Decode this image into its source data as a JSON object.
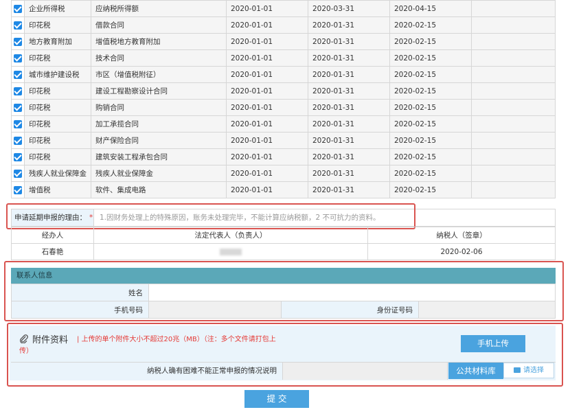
{
  "tax_rows": [
    {
      "type": "企业所得税",
      "item": "应纳税所得额",
      "start": "2020-01-01",
      "end": "2020-03-31",
      "due": "2020-04-15"
    },
    {
      "type": "印花税",
      "item": "借款合同",
      "start": "2020-01-01",
      "end": "2020-01-31",
      "due": "2020-02-15"
    },
    {
      "type": "地方教育附加",
      "item": "增值税地方教育附加",
      "start": "2020-01-01",
      "end": "2020-01-31",
      "due": "2020-02-15"
    },
    {
      "type": "印花税",
      "item": "技术合同",
      "start": "2020-01-01",
      "end": "2020-01-31",
      "due": "2020-02-15"
    },
    {
      "type": "城市维护建设税",
      "item": "市区（增值税附征）",
      "start": "2020-01-01",
      "end": "2020-01-31",
      "due": "2020-02-15"
    },
    {
      "type": "印花税",
      "item": "建设工程勘察设计合同",
      "start": "2020-01-01",
      "end": "2020-01-31",
      "due": "2020-02-15"
    },
    {
      "type": "印花税",
      "item": "购销合同",
      "start": "2020-01-01",
      "end": "2020-01-31",
      "due": "2020-02-15"
    },
    {
      "type": "印花税",
      "item": "加工承揽合同",
      "start": "2020-01-01",
      "end": "2020-01-31",
      "due": "2020-02-15"
    },
    {
      "type": "印花税",
      "item": "财产保险合同",
      "start": "2020-01-01",
      "end": "2020-01-31",
      "due": "2020-02-15"
    },
    {
      "type": "印花税",
      "item": "建筑安装工程承包合同",
      "start": "2020-01-01",
      "end": "2020-01-31",
      "due": "2020-02-15"
    },
    {
      "type": "残疾人就业保障金",
      "item": "残疾人就业保障金",
      "start": "2020-01-01",
      "end": "2020-01-31",
      "due": "2020-02-15"
    },
    {
      "type": "增值税",
      "item": "软件、集成电路",
      "start": "2020-01-01",
      "end": "2020-01-31",
      "due": "2020-02-15"
    }
  ],
  "reason": {
    "label": "申请延期申报的理由：",
    "required_mark": "*",
    "text": "1.因财务处理上的特殊原因，账务未处理完毕，不能计算应纳税额，2 不可抗力的资料。"
  },
  "signature": {
    "handler_label": "经办人",
    "legal_rep_label": "法定代表人（负责人）",
    "taxpayer_label": "纳税人（签章）",
    "handler_name": "石春艳",
    "date": "2020-02-06"
  },
  "contact": {
    "header": "联系人信息",
    "name_label": "姓名",
    "phone_label": "手机号码",
    "id_label": "身份证号码"
  },
  "attachments": {
    "title": "附件资料",
    "note": "| 上传的单个附件大小不超过20兆（MB）（注：多个文件请打包上传）",
    "mobile_upload": "手机上传",
    "explain_label": "纳税人确有困难不能正常申报的情况说明",
    "public_materials": "公共材料库",
    "choose": "请选择"
  },
  "submit_label": "提 交",
  "colors": {
    "accent": "#4aa3df",
    "highlight": "#d9534f",
    "header_teal": "#5ba8b8"
  }
}
